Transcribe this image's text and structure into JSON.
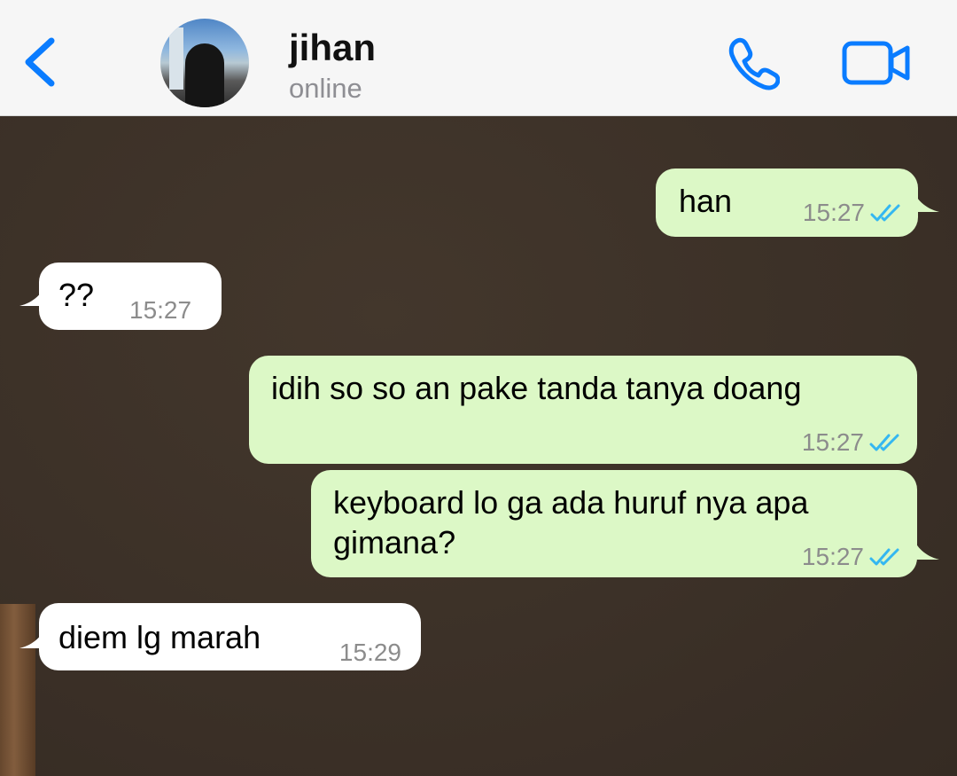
{
  "header": {
    "contact_name": "jihan",
    "status": "online"
  },
  "colors": {
    "accent": "#0a7cff",
    "outgoing_bubble": "#dcf8c6",
    "incoming_bubble": "#ffffff",
    "read_ticks": "#34b7f1",
    "chat_background": "#3a2f26"
  },
  "icons": [
    "back-chevron-icon",
    "phone-icon",
    "video-camera-icon",
    "double-check-read-icon"
  ],
  "messages": [
    {
      "direction": "out",
      "text": "han",
      "time": "15:27",
      "read": true
    },
    {
      "direction": "in",
      "text": "??",
      "time": "15:27"
    },
    {
      "direction": "out",
      "text": "idih so so an pake tanda tanya doang",
      "time": "15:27",
      "read": true
    },
    {
      "direction": "out",
      "text_line1": "keyboard lo ga ada huruf nya apa",
      "text_line2": "gimana?",
      "time": "15:27",
      "read": true
    },
    {
      "direction": "in",
      "text": "diem lg marah",
      "time": "15:29"
    }
  ]
}
